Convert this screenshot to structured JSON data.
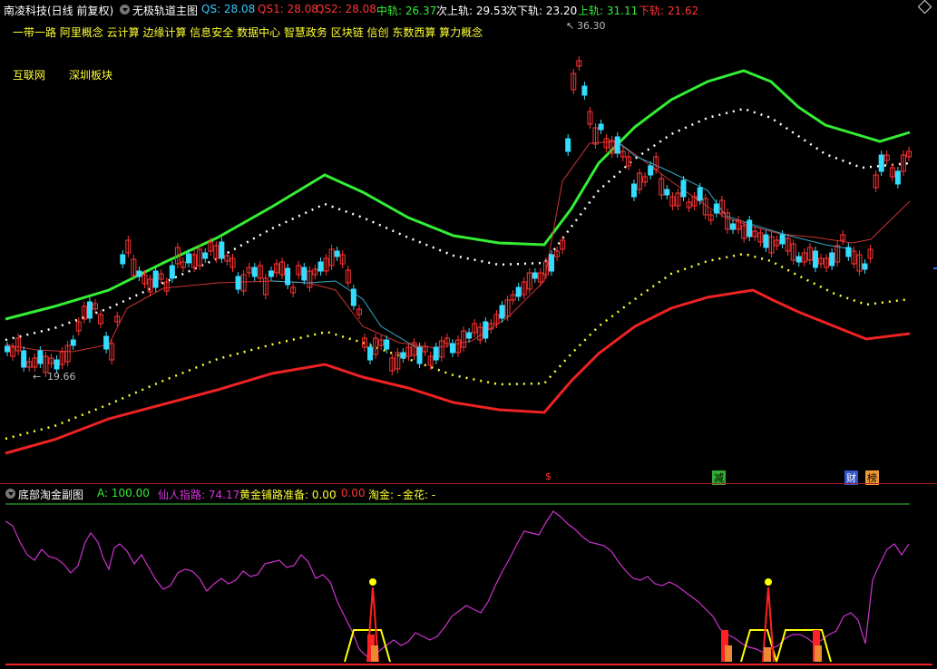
{
  "header": {
    "stock_title": "南凌科技(日线 前复权)",
    "indicator_dropdown": "无极轨道主图",
    "qs": "QS: 28.08",
    "qs1": "QS1: 28.08",
    "qs2": "QS2: 28.08",
    "mid": "中轨: 26.37",
    "upper2": "次上轨: 29.53",
    "lower2": "次下轨: 23.20",
    "upper": "上轨: 31.11",
    "lower": "下轨: 21.62"
  },
  "concepts": {
    "line1": "一带一路 阿里概念 云计算 边缘计算 信息安全 数据中心 智慧政务 区块链 信创 东数西算 算力概念",
    "item_a": "互联网",
    "item_b": "深圳板块"
  },
  "price_labels": {
    "high": "36.30",
    "low": "19.66"
  },
  "markers": {
    "dollar": "$",
    "reduce": "减",
    "finance": "财",
    "rank": "榜"
  },
  "sub_header": {
    "title": "底部淘金副图",
    "a": "A: 100.00",
    "xianren": "仙人指路: 74.17",
    "huangjin": "黄金铺路准备: 0.00",
    "huangjin_val2": ": 0.00",
    "taojin": "淘金: -",
    "jinhua": "金花: -"
  },
  "colors": {
    "bg": "#000000",
    "up_candle": "#ff3333",
    "down_candle": "#33ddff",
    "upper_band": "#33ee33",
    "lower_band": "#ee2222",
    "dotted_upper": "#ffffff",
    "dotted_lower": "#ffff33",
    "ma_line": "#33aacc",
    "sub_line": "#cc33cc",
    "yellow": "#ffff00"
  }
}
